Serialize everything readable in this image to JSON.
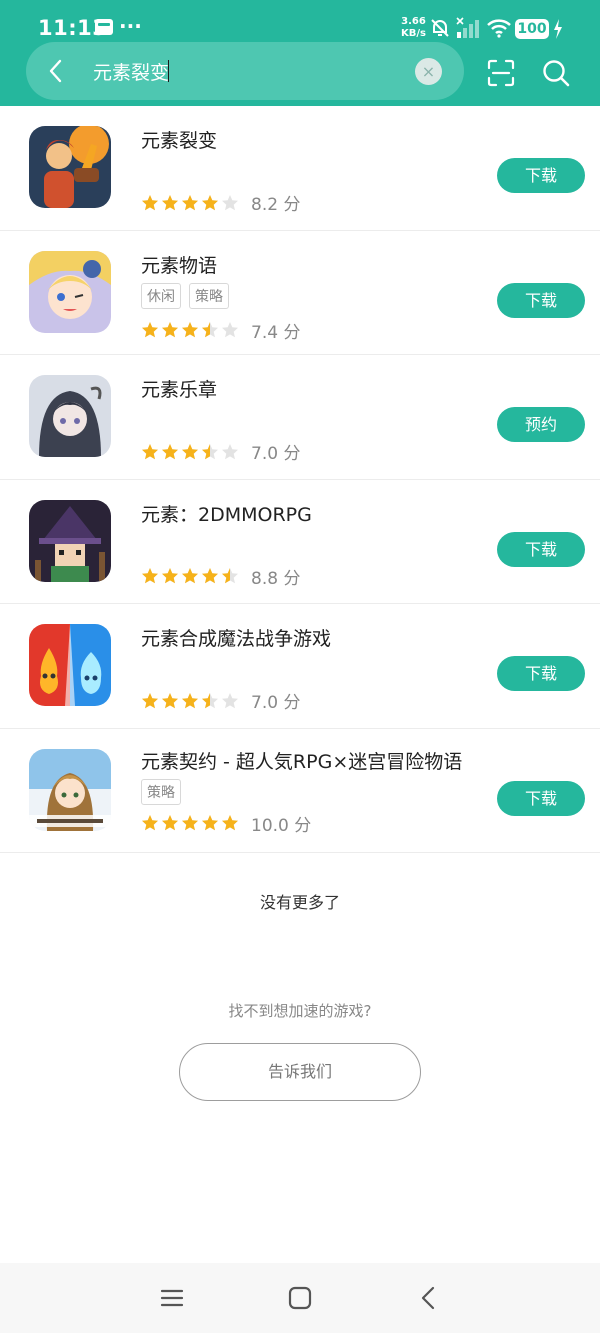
{
  "status_bar": {
    "time": "11:13",
    "dots": "···",
    "net_speed_value": "3.66",
    "net_speed_unit": "KB/s",
    "battery": "100"
  },
  "search": {
    "query": "元素裂变",
    "clear_label": "×"
  },
  "colors": {
    "brand": "#25b79d",
    "star_filled": "#f6b21a",
    "star_empty": "#e3e3e3"
  },
  "results": [
    {
      "title": "元素裂变",
      "tags": [],
      "rating": 4,
      "score": "8.2 分",
      "action": "下载"
    },
    {
      "title": "元素物语",
      "tags": [
        "休闲",
        "策略"
      ],
      "rating": 3.5,
      "score": "7.4 分",
      "action": "下载"
    },
    {
      "title": "元素乐章",
      "tags": [],
      "rating": 3.5,
      "score": "7.0 分",
      "action": "预约"
    },
    {
      "title": "元素：2DMMORPG",
      "tags": [],
      "rating": 4.5,
      "score": "8.8 分",
      "action": "下载"
    },
    {
      "title": "元素合成魔法战争游戏",
      "tags": [],
      "rating": 3.5,
      "score": "7.0 分",
      "action": "下载"
    },
    {
      "title": "元素契约 - 超人気RPG×迷宫冒险物语",
      "tags": [
        "策略"
      ],
      "rating": 5,
      "score": "10.0 分",
      "action": "下载"
    }
  ],
  "footer": {
    "no_more": "没有更多了",
    "cant_find": "找不到想加速的游戏?",
    "tell_us": "告诉我们"
  }
}
